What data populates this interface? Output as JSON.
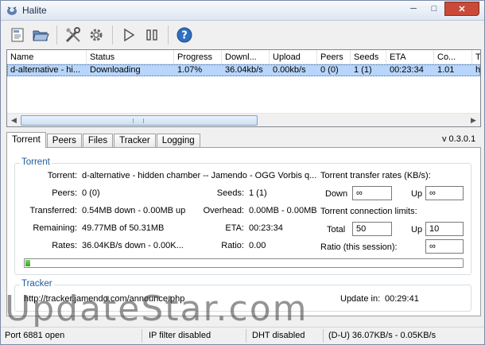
{
  "window": {
    "title": "Halite"
  },
  "toolbar": {
    "buttons": [
      "add-torrent-icon",
      "open-folder-icon",
      "tools-icon",
      "settings-gear-icon",
      "resume-icon",
      "pause-icon",
      "help-icon"
    ]
  },
  "list": {
    "columns": [
      "Name",
      "Status",
      "Progress",
      "Downl...",
      "Upload",
      "Peers",
      "Seeds",
      "ETA",
      "Co...",
      "Tr"
    ],
    "rows": [
      {
        "name": "d-alternative - hi...",
        "status": "Downloading",
        "progress": "1.07%",
        "download": "36.04kb/s",
        "upload": "0.00kb/s",
        "peers": "0 (0)",
        "seeds": "1 (1)",
        "eta": "00:23:34",
        "copies": "1.01",
        "tracker": "ht"
      }
    ]
  },
  "tabs": [
    "Torrent",
    "Peers",
    "Files",
    "Tracker",
    "Logging"
  ],
  "version": "v 0.3.0.1",
  "torrent_group": {
    "legend": "Torrent",
    "torrent_label": "Torrent:",
    "torrent_value": "d-alternative - hidden chamber -- Jamendo - OGG Vorbis q...",
    "peers_label": "Peers:",
    "peers_value": "0 (0)",
    "seeds_label": "Seeds:",
    "seeds_value": "1 (1)",
    "transferred_label": "Transferred:",
    "transferred_value": "0.54MB down - 0.00MB up",
    "overhead_label": "Overhead:",
    "overhead_value": "0.00MB - 0.00MB",
    "remaining_label": "Remaining:",
    "remaining_value": "49.77MB of 50.31MB",
    "eta_label": "ETA:",
    "eta_value": "00:23:34",
    "rates_label": "Rates:",
    "rates_value": "36.04KB/s down - 0.00K...",
    "ratio_label": "Ratio:",
    "ratio_value": "0.00",
    "progress_fraction": 0.0107
  },
  "limits": {
    "rates_title": "Torrent transfer rates (KB/s):",
    "down_label": "Down",
    "down_value": "∞",
    "up_label": "Up",
    "up_value": "∞",
    "conn_title": "Torrent connection limits:",
    "total_label": "Total",
    "total_value": "50",
    "conn_up_label": "Up",
    "conn_up_value": "10",
    "ratio_label": "Ratio (this session):",
    "ratio_value": "∞"
  },
  "tracker_group": {
    "legend": "Tracker",
    "url": "http://tracker.jamendo.com/announce.php",
    "update_label": "Update in:",
    "update_value": "00:29:41"
  },
  "watermark": "UpdateStar.com",
  "statusbar": {
    "port": "Port 6881 open",
    "ipfilter": "IP filter disabled",
    "dht": "DHT disabled",
    "rates": "(D-U) 36.07KB/s - 0.05KB/s"
  },
  "colors": {
    "selection": "#b8d6fb",
    "legend": "#1d5a9e",
    "progress": "#37a51f"
  }
}
